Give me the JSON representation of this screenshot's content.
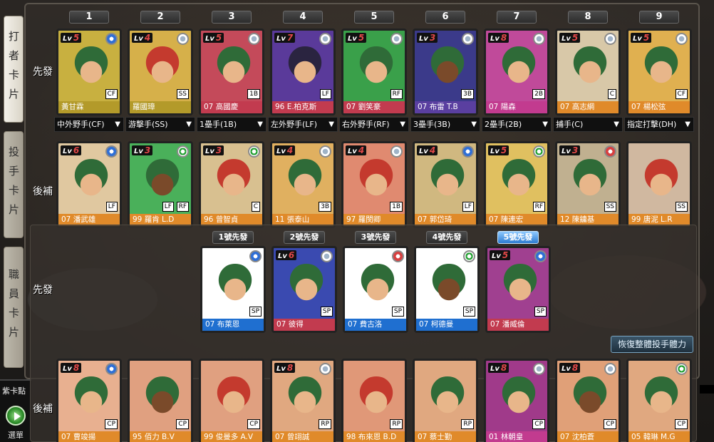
{
  "side_tabs": [
    {
      "label": "打者卡片",
      "active": true
    },
    {
      "label": "投手卡片",
      "active": false
    },
    {
      "label": "職員卡片",
      "active": false
    }
  ],
  "purple_points_label": "紫卡點",
  "menu_label": "選單",
  "column_numbers": [
    "1",
    "2",
    "3",
    "4",
    "5",
    "6",
    "7",
    "8",
    "9"
  ],
  "row_labels": {
    "starters": "先發",
    "bench": "後補",
    "pitch_starters": "先發",
    "pitch_bench": "後補"
  },
  "starters": [
    {
      "lv": "5",
      "name": "黃甘霖",
      "pos": "CF",
      "medal": "blue",
      "bg": "#c8b040",
      "name_bg": "#b39a2a",
      "face": "normal"
    },
    {
      "lv": "4",
      "name": "羅國璋",
      "pos": "SS",
      "medal": "silver",
      "bg": "#d6b04a",
      "name_bg": "#b39a2a",
      "face": "red"
    },
    {
      "lv": "5",
      "name": "07 高國慶",
      "pos": "1B",
      "medal": "silver",
      "bg": "#c44a5a",
      "name_bg": "#c23b4f",
      "face": "normal"
    },
    {
      "lv": "7",
      "name": "96 E.柏克斯",
      "pos": "LF",
      "medal": "silver",
      "bg": "#5a3a9a",
      "name_bg": "#c23b4f",
      "face": "purple"
    },
    {
      "lv": "5",
      "name": "07 劉笑豪",
      "pos": "RF",
      "medal": "silver",
      "bg": "#3aa04a",
      "name_bg": "#c23b4f",
      "face": "normal"
    },
    {
      "lv": "3",
      "name": "07 布雷 T.B",
      "pos": "3B",
      "medal": "silver",
      "bg": "#3b3a8a",
      "name_bg": "#5a3fa0",
      "face": "dark"
    },
    {
      "lv": "8",
      "name": "07 陽森",
      "pos": "2B",
      "medal": "silver",
      "bg": "#c04a9a",
      "name_bg": "#c23b8f",
      "face": "normal"
    },
    {
      "lv": "5",
      "name": "07 高志綱",
      "pos": "C",
      "medal": "silver",
      "bg": "#d8c8a8",
      "name_bg": "#e08a2a",
      "face": "normal"
    },
    {
      "lv": "5",
      "name": "07 楊松弦",
      "pos": "CF",
      "medal": "silver",
      "bg": "#e0b050",
      "name_bg": "#e08a2a",
      "face": "normal"
    }
  ],
  "position_selects": [
    "中外野手(CF)",
    "游擊手(SS)",
    "1壘手(1B)",
    "左外野手(LF)",
    "右外野手(RF)",
    "3壘手(3B)",
    "2壘手(2B)",
    "捕手(C)",
    "指定打擊(DH)"
  ],
  "bench": [
    {
      "lv": "6",
      "name": "07 潘武雄",
      "pos": "LF",
      "pos2": "",
      "medal": "blue",
      "bg": "#e0c8a0",
      "name_bg": "#e08a2a",
      "face": "normal"
    },
    {
      "lv": "3",
      "name": "99 羅肯 L.D",
      "pos": "RF",
      "pos2": "LF",
      "medal": "green",
      "bg": "#4ab05a",
      "name_bg": "#e08a2a",
      "face": "dark"
    },
    {
      "lv": "3",
      "name": "96 曾智貞",
      "pos": "C",
      "pos2": "",
      "medal": "green",
      "bg": "#d8c090",
      "name_bg": "#e08a2a",
      "face": "red"
    },
    {
      "lv": "4",
      "name": "11 張泰山",
      "pos": "3B",
      "pos2": "",
      "medal": "silver",
      "bg": "#e0b060",
      "name_bg": "#e08a2a",
      "face": "normal"
    },
    {
      "lv": "4",
      "name": "97 羅閔卿",
      "pos": "1B",
      "pos2": "",
      "medal": "silver",
      "bg": "#e08a70",
      "name_bg": "#e08a2a",
      "face": "red"
    },
    {
      "lv": "4",
      "name": "07 郭岱琦",
      "pos": "LF",
      "pos2": "",
      "medal": "blue",
      "bg": "#d0b880",
      "name_bg": "#e08a2a",
      "face": "normal"
    },
    {
      "lv": "5",
      "name": "07 陳連宏",
      "pos": "RF",
      "pos2": "",
      "medal": "green",
      "bg": "#e0c060",
      "name_bg": "#e08a2a",
      "face": "normal"
    },
    {
      "lv": "3",
      "name": "12 陳鏞基",
      "pos": "SS",
      "pos2": "",
      "medal": "red",
      "bg": "#c0b090",
      "name_bg": "#e08a2a",
      "face": "normal"
    },
    {
      "lv": "",
      "name": "99 唐泥 L.R",
      "pos": "SS",
      "pos2": "",
      "medal": "",
      "bg": "#d0b8a0",
      "name_bg": "#e08a2a",
      "face": "red"
    }
  ],
  "pitcher_slots": [
    "1號先發",
    "2號先發",
    "3號先發",
    "4號先發",
    "5號先發"
  ],
  "pitcher_starters": [
    {
      "lv": "",
      "name": "07 布萊恩",
      "pos": "SP",
      "medal": "blue",
      "bg": "#ffffff",
      "name_bg": "#1f6fd0",
      "face": "normal"
    },
    {
      "lv": "6",
      "name": "07 彼得",
      "pos": "SP",
      "medal": "silver",
      "bg": "#3a4ab0",
      "name_bg": "#c23b4f",
      "face": "normal"
    },
    {
      "lv": "",
      "name": "07 費古洛",
      "pos": "SP",
      "medal": "red",
      "bg": "#ffffff",
      "name_bg": "#1f6fd0",
      "face": "normal"
    },
    {
      "lv": "",
      "name": "07 柯德曼",
      "pos": "SP",
      "medal": "green",
      "bg": "#ffffff",
      "name_bg": "#1f6fd0",
      "face": "dark"
    },
    {
      "lv": "5",
      "name": "07 潘威倫",
      "pos": "SP",
      "medal": "blue",
      "bg": "#a04090",
      "name_bg": "#c23b4f",
      "face": "normal"
    }
  ],
  "restore_label": "恢復整體投手體力",
  "pitcher_bench": [
    {
      "lv": "8",
      "name": "07 曹竣揚",
      "pos": "CP",
      "medal": "blue",
      "bg": "#e8b090",
      "name_bg": "#e08a2a",
      "face": "normal"
    },
    {
      "lv": "",
      "name": "95 佰力 B.V",
      "pos": "CP",
      "medal": "",
      "bg": "#e0a080",
      "name_bg": "#e08a2a",
      "face": "dark"
    },
    {
      "lv": "",
      "name": "99 俊曼多 A.V",
      "pos": "CP",
      "medal": "",
      "bg": "#e0a080",
      "name_bg": "#e08a2a",
      "face": "red"
    },
    {
      "lv": "8",
      "name": "07 曾翊誠",
      "pos": "RP",
      "medal": "silver",
      "bg": "#e0a880",
      "name_bg": "#e08a2a",
      "face": "normal"
    },
    {
      "lv": "",
      "name": "98 布來恩 B.D",
      "pos": "RP",
      "medal": "",
      "bg": "#e09878",
      "name_bg": "#e08a2a",
      "face": "red"
    },
    {
      "lv": "",
      "name": "07 蔡士勤",
      "pos": "RP",
      "medal": "",
      "bg": "#e0a880",
      "name_bg": "#e08a2a",
      "face": "normal"
    },
    {
      "lv": "8",
      "name": "01 林朝皇",
      "pos": "CP",
      "medal": "silver",
      "bg": "#a03a8a",
      "name_bg": "#c23b8f",
      "face": "normal"
    },
    {
      "lv": "8",
      "name": "07 沈柏蒼",
      "pos": "CP",
      "medal": "silver",
      "bg": "#e0a078",
      "name_bg": "#e08a2a",
      "face": "dark"
    },
    {
      "lv": "",
      "name": "05 韓琳 M.G",
      "pos": "CP",
      "medal": "green",
      "bg": "#e0a880",
      "name_bg": "#e08a2a",
      "face": "normal"
    }
  ]
}
